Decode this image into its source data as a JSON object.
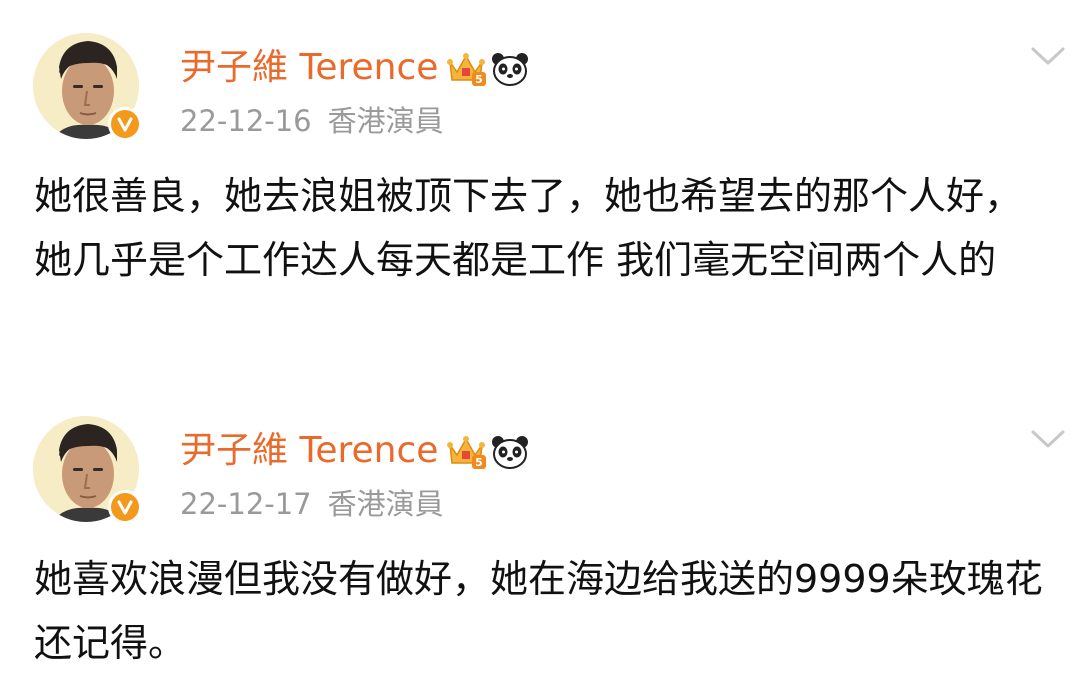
{
  "posts": [
    {
      "username": "尹子維 Terence",
      "date": "22-12-16",
      "source": "香港演員",
      "text": "她很善良，她去浪姐被顶下去了，她也希望去的那个人好，她几乎是个工作达人每天都是工作 我们毫无空间两个人的"
    },
    {
      "username": "尹子維 Terence",
      "date": "22-12-17",
      "source": "香港演員",
      "text": "她喜欢浪漫但我没有做好，她在海边给我送的9999朵玫瑰花还记得。"
    }
  ],
  "colors": {
    "username": "#ea6a2b",
    "meta": "#9a9a9a",
    "verified_badge": "#f39a1c",
    "text": "#111111"
  },
  "icons": {
    "badge": "verified-v-icon",
    "crown": "crown-vip-icon",
    "panda": "panda-icon",
    "menu": "chevron-down-icon"
  }
}
